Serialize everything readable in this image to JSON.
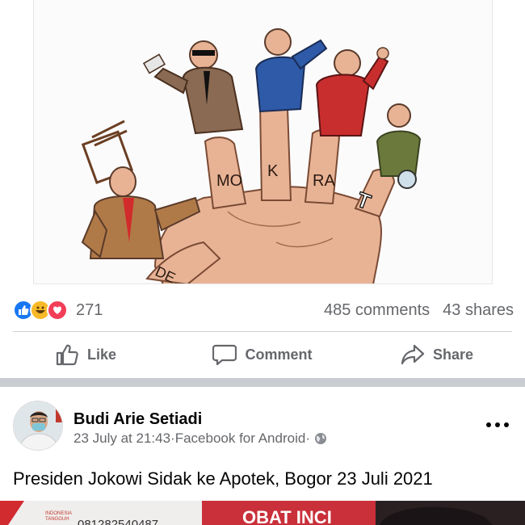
{
  "post1": {
    "image": {
      "letters": [
        "DE",
        "MO",
        "K",
        "RA",
        "T"
      ]
    },
    "reactions": {
      "icons": [
        "like-icon",
        "haha-icon",
        "love-icon"
      ],
      "count": "271",
      "comments": "485 comments",
      "shares": "43 shares"
    },
    "actions": {
      "like": "Like",
      "comment": "Comment",
      "share": "Share"
    }
  },
  "post2": {
    "author": "Budi Arie Setiadi",
    "date": "23 July at 21:43",
    "separator": " · ",
    "source": "Facebook for Android",
    "separator2": " · ",
    "privacy_icon": "globe-icon",
    "text": "Presiden Jokowi Sidak ke Apotek, Bogor 23 Juli 2021",
    "image_peek": {
      "logo_line1": "INDONESIA",
      "logo_line2": "TANGGUH",
      "phone": "081282540487",
      "sign": "OBAT INCI"
    }
  },
  "colors": {
    "facebook_blue": "#1877f2",
    "secondary_text": "#65676b",
    "divider": "#ced0d4",
    "band": "#c9ccd1"
  }
}
